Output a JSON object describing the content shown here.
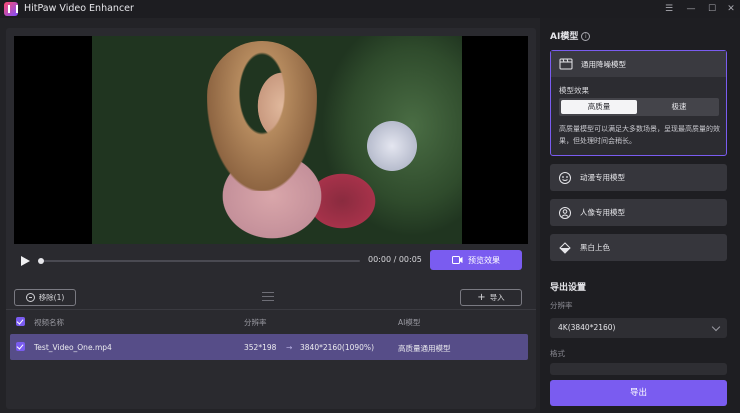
{
  "app": {
    "title": "HitPaw Video Enhancer"
  },
  "window_controls": {
    "menu": "☰",
    "minimize": "—",
    "maximize": "☐",
    "close": "✕"
  },
  "player": {
    "time": "00:00 / 00:05",
    "preview_label": "预览效果",
    "progress": 0.0
  },
  "list": {
    "remove_label": "移除(1)",
    "import_label": "导入",
    "columns": [
      "视频名称",
      "分辨率",
      "AI模型"
    ],
    "rows": [
      {
        "name": "Test_Video_One.mp4",
        "res_from": "352*198",
        "res_to": "3840*2160(1090%)",
        "model": "高质量通用模型"
      }
    ]
  },
  "sidebar": {
    "ai_title": "AI模型",
    "info_glyph": "i",
    "general_model": "通用降噪模型",
    "effect_label": "模型效果",
    "effect_options": [
      "高质量",
      "极速"
    ],
    "effect_selected": "高质量",
    "description": "高质量模型可以满足大多数场景，呈现最高质量的效果，但处理时间会稍长。",
    "other_models": [
      "动漫专用模型",
      "人像专用模型",
      "黑白上色"
    ],
    "export_title": "导出设置",
    "resolution_label": "分辨率",
    "resolution_value": "4K(3840*2160)",
    "format_label": "格式",
    "export_label": "导出"
  },
  "colors": {
    "accent": "#7a5cf0",
    "selected_row": "#564d88"
  }
}
